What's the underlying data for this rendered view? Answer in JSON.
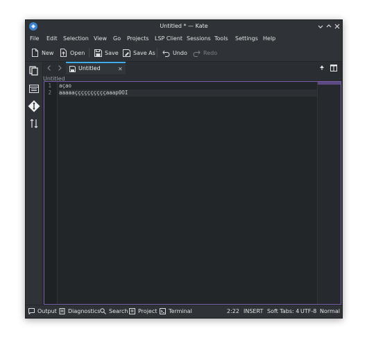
{
  "window": {
    "title": "Untitled * — Kate"
  },
  "menubar": {
    "items": [
      "File",
      "Edit",
      "Selection",
      "View",
      "Go",
      "Projects",
      "LSP Client",
      "Sessions",
      "Tools",
      "Settings",
      "Help"
    ]
  },
  "toolbar": {
    "new_label": "New",
    "open_label": "Open",
    "save_label": "Save",
    "save_as_label": "Save As",
    "undo_label": "Undo",
    "redo_label": "Redo"
  },
  "tabs": [
    {
      "label": "Untitled",
      "modified": true
    }
  ],
  "breadcrumb": "Untitled",
  "editor": {
    "lines": [
      {
        "number": "1",
        "text": "açao"
      },
      {
        "number": "2",
        "text": "aaaaaççççççççççaaap0OI"
      }
    ]
  },
  "statusbar": {
    "output_label": "Output",
    "diagnostics_label": "Diagnostics",
    "search_label": "Search",
    "project_label": "Project",
    "terminal_label": "Terminal",
    "cursor_position": "2:22",
    "input_mode": "INSERT",
    "indentation": "Soft Tabs: 4",
    "encoding": "UTF-8",
    "mode": "Normal"
  },
  "colors": {
    "accent": "#3daee9",
    "editor_border": "#7a5fa8",
    "background": "#2a2e32"
  },
  "icons": [
    "kate-app-icon",
    "minimize-icon",
    "maximize-icon",
    "close-icon",
    "new-document-icon",
    "open-folder-icon",
    "save-icon",
    "save-as-icon",
    "undo-icon",
    "redo-icon",
    "documents-icon",
    "symbols-icon",
    "git-icon",
    "projects-icon",
    "back-icon",
    "forward-icon",
    "quick-open-icon",
    "split-view-icon",
    "output-icon",
    "diagnostics-icon",
    "search-icon",
    "project-icon",
    "terminal-icon"
  ]
}
